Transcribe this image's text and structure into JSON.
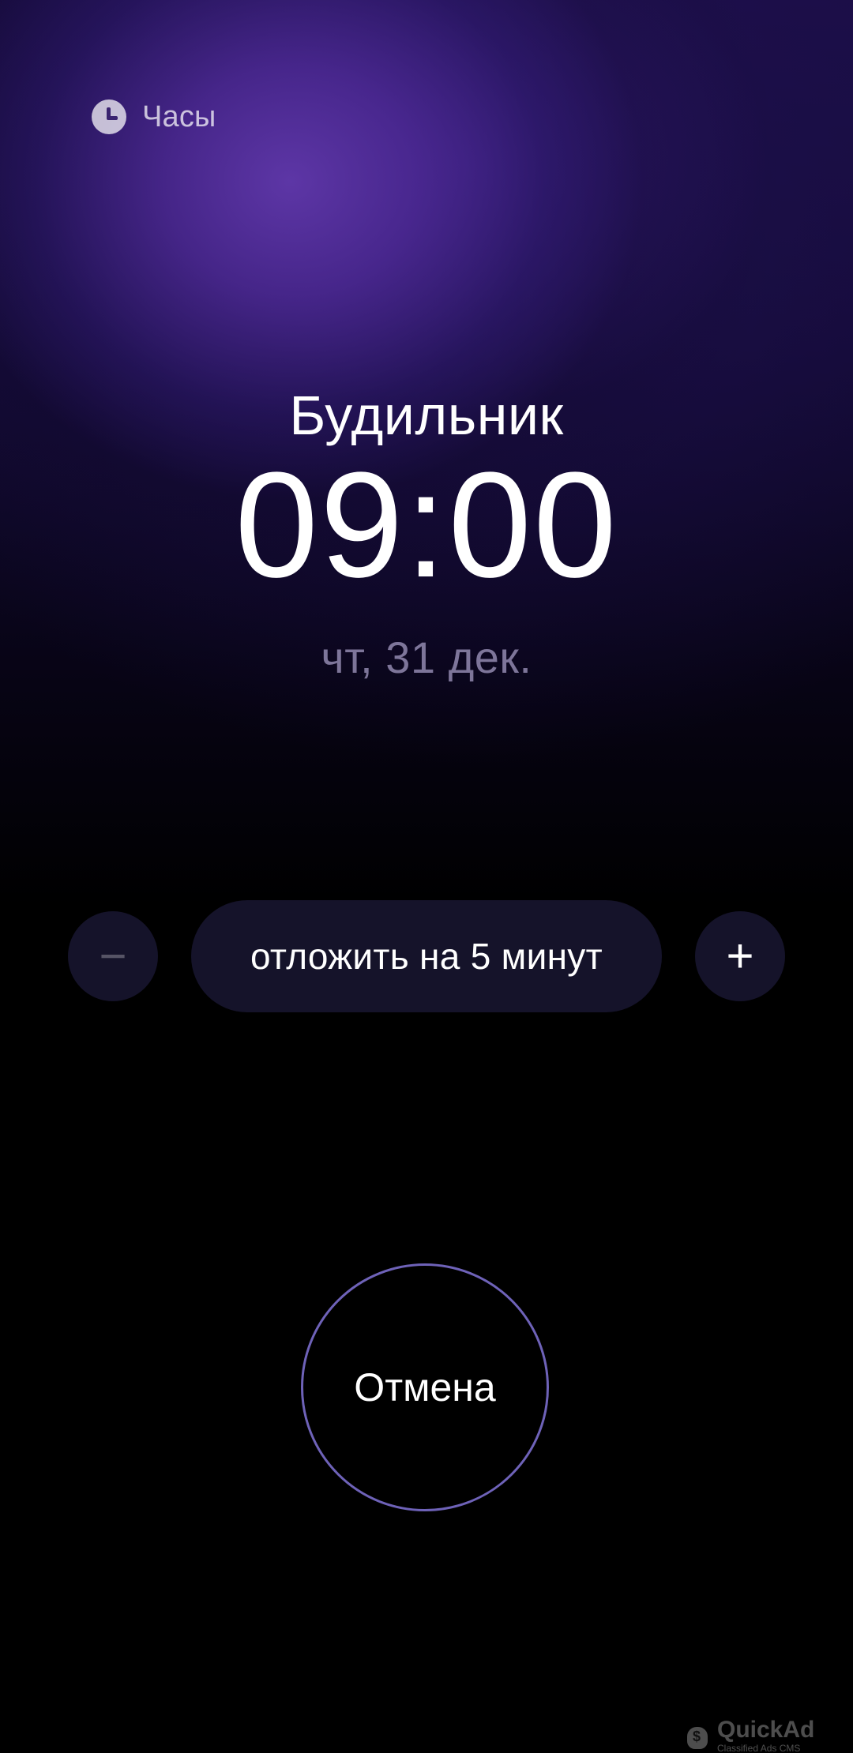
{
  "app": {
    "name": "Часы",
    "icon": "clock-icon"
  },
  "alarm": {
    "title": "Будильник",
    "time": "09:00",
    "date": "чт, 31 дек."
  },
  "snooze": {
    "label": "отложить на 5 минут",
    "minus": "−",
    "plus": "+"
  },
  "actions": {
    "cancel": "Отмена"
  },
  "watermark": {
    "brand": "QuickAd",
    "subtitle": "Classified Ads CMS"
  },
  "colors": {
    "accent_ring": "#6e62b8",
    "button_bg": "#15132a",
    "purple_glow": "#5a32a8"
  }
}
